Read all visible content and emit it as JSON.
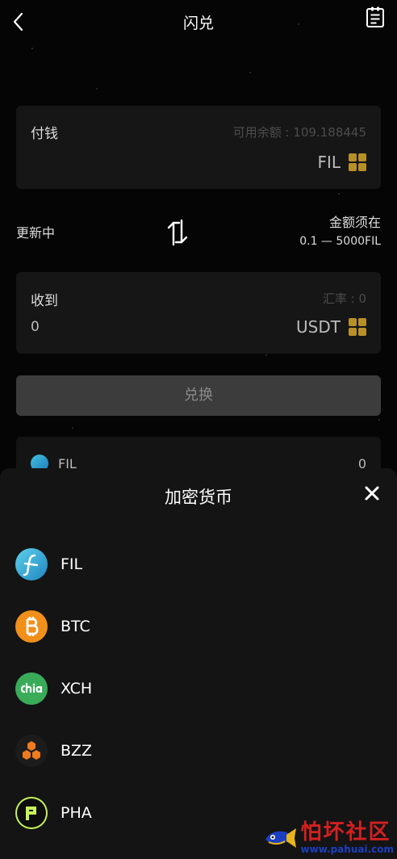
{
  "header": {
    "title": "闪兑"
  },
  "pay": {
    "label": "付钱",
    "available": "可用余额 : 109.188445",
    "currency": "FIL"
  },
  "middle": {
    "status": "更新中",
    "limit_title": "金额须在",
    "limit_range": "0.1 — 5000FIL"
  },
  "receive": {
    "label": "收到",
    "rate": "汇率 : 0",
    "amount": "0",
    "currency": "USDT"
  },
  "exchange_button": "兑换",
  "balance": {
    "name": "FIL",
    "value": "0"
  },
  "sheet": {
    "title": "加密货币",
    "coins": [
      {
        "name": "FIL",
        "icon": "fil-icon"
      },
      {
        "name": "BTC",
        "icon": "btc-icon"
      },
      {
        "name": "XCH",
        "icon": "chia-icon"
      },
      {
        "name": "BZZ",
        "icon": "bzz-icon"
      },
      {
        "name": "PHA",
        "icon": "pha-icon"
      }
    ]
  },
  "watermark": {
    "name": "怕坏社区",
    "url": "www.pahuai.com"
  },
  "colors": {
    "accent_gold": "#b8902a",
    "background": "#050505",
    "card": "#161616",
    "button_disabled": "#3c3c3c"
  }
}
